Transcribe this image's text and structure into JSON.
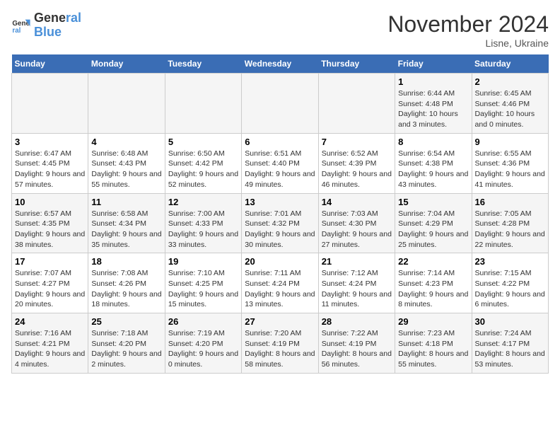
{
  "header": {
    "logo_line1": "General",
    "logo_line2": "Blue",
    "title": "November 2024",
    "subtitle": "Lisne, Ukraine"
  },
  "columns": [
    "Sunday",
    "Monday",
    "Tuesday",
    "Wednesday",
    "Thursday",
    "Friday",
    "Saturday"
  ],
  "weeks": [
    {
      "days": [
        {
          "num": "",
          "info": ""
        },
        {
          "num": "",
          "info": ""
        },
        {
          "num": "",
          "info": ""
        },
        {
          "num": "",
          "info": ""
        },
        {
          "num": "",
          "info": ""
        },
        {
          "num": "1",
          "info": "Sunrise: 6:44 AM\nSunset: 4:48 PM\nDaylight: 10 hours and 3 minutes."
        },
        {
          "num": "2",
          "info": "Sunrise: 6:45 AM\nSunset: 4:46 PM\nDaylight: 10 hours and 0 minutes."
        }
      ]
    },
    {
      "days": [
        {
          "num": "3",
          "info": "Sunrise: 6:47 AM\nSunset: 4:45 PM\nDaylight: 9 hours and 57 minutes."
        },
        {
          "num": "4",
          "info": "Sunrise: 6:48 AM\nSunset: 4:43 PM\nDaylight: 9 hours and 55 minutes."
        },
        {
          "num": "5",
          "info": "Sunrise: 6:50 AM\nSunset: 4:42 PM\nDaylight: 9 hours and 52 minutes."
        },
        {
          "num": "6",
          "info": "Sunrise: 6:51 AM\nSunset: 4:40 PM\nDaylight: 9 hours and 49 minutes."
        },
        {
          "num": "7",
          "info": "Sunrise: 6:52 AM\nSunset: 4:39 PM\nDaylight: 9 hours and 46 minutes."
        },
        {
          "num": "8",
          "info": "Sunrise: 6:54 AM\nSunset: 4:38 PM\nDaylight: 9 hours and 43 minutes."
        },
        {
          "num": "9",
          "info": "Sunrise: 6:55 AM\nSunset: 4:36 PM\nDaylight: 9 hours and 41 minutes."
        }
      ]
    },
    {
      "days": [
        {
          "num": "10",
          "info": "Sunrise: 6:57 AM\nSunset: 4:35 PM\nDaylight: 9 hours and 38 minutes."
        },
        {
          "num": "11",
          "info": "Sunrise: 6:58 AM\nSunset: 4:34 PM\nDaylight: 9 hours and 35 minutes."
        },
        {
          "num": "12",
          "info": "Sunrise: 7:00 AM\nSunset: 4:33 PM\nDaylight: 9 hours and 33 minutes."
        },
        {
          "num": "13",
          "info": "Sunrise: 7:01 AM\nSunset: 4:32 PM\nDaylight: 9 hours and 30 minutes."
        },
        {
          "num": "14",
          "info": "Sunrise: 7:03 AM\nSunset: 4:30 PM\nDaylight: 9 hours and 27 minutes."
        },
        {
          "num": "15",
          "info": "Sunrise: 7:04 AM\nSunset: 4:29 PM\nDaylight: 9 hours and 25 minutes."
        },
        {
          "num": "16",
          "info": "Sunrise: 7:05 AM\nSunset: 4:28 PM\nDaylight: 9 hours and 22 minutes."
        }
      ]
    },
    {
      "days": [
        {
          "num": "17",
          "info": "Sunrise: 7:07 AM\nSunset: 4:27 PM\nDaylight: 9 hours and 20 minutes."
        },
        {
          "num": "18",
          "info": "Sunrise: 7:08 AM\nSunset: 4:26 PM\nDaylight: 9 hours and 18 minutes."
        },
        {
          "num": "19",
          "info": "Sunrise: 7:10 AM\nSunset: 4:25 PM\nDaylight: 9 hours and 15 minutes."
        },
        {
          "num": "20",
          "info": "Sunrise: 7:11 AM\nSunset: 4:24 PM\nDaylight: 9 hours and 13 minutes."
        },
        {
          "num": "21",
          "info": "Sunrise: 7:12 AM\nSunset: 4:24 PM\nDaylight: 9 hours and 11 minutes."
        },
        {
          "num": "22",
          "info": "Sunrise: 7:14 AM\nSunset: 4:23 PM\nDaylight: 9 hours and 8 minutes."
        },
        {
          "num": "23",
          "info": "Sunrise: 7:15 AM\nSunset: 4:22 PM\nDaylight: 9 hours and 6 minutes."
        }
      ]
    },
    {
      "days": [
        {
          "num": "24",
          "info": "Sunrise: 7:16 AM\nSunset: 4:21 PM\nDaylight: 9 hours and 4 minutes."
        },
        {
          "num": "25",
          "info": "Sunrise: 7:18 AM\nSunset: 4:20 PM\nDaylight: 9 hours and 2 minutes."
        },
        {
          "num": "26",
          "info": "Sunrise: 7:19 AM\nSunset: 4:20 PM\nDaylight: 9 hours and 0 minutes."
        },
        {
          "num": "27",
          "info": "Sunrise: 7:20 AM\nSunset: 4:19 PM\nDaylight: 8 hours and 58 minutes."
        },
        {
          "num": "28",
          "info": "Sunrise: 7:22 AM\nSunset: 4:19 PM\nDaylight: 8 hours and 56 minutes."
        },
        {
          "num": "29",
          "info": "Sunrise: 7:23 AM\nSunset: 4:18 PM\nDaylight: 8 hours and 55 minutes."
        },
        {
          "num": "30",
          "info": "Sunrise: 7:24 AM\nSunset: 4:17 PM\nDaylight: 8 hours and 53 minutes."
        }
      ]
    }
  ]
}
